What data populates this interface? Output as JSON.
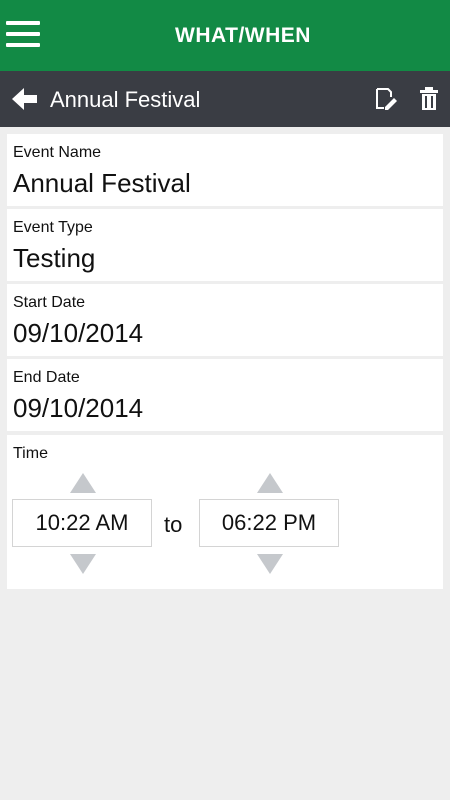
{
  "header": {
    "title": "WHAT/WHEN",
    "menu_icon": "hamburger-menu-icon"
  },
  "subheader": {
    "title": "Annual Festival",
    "back_icon": "back-arrow-icon",
    "edit_icon": "edit-icon",
    "delete_icon": "trash-icon"
  },
  "fields": [
    {
      "label": "Event Name",
      "value": "Annual Festival"
    },
    {
      "label": "Event Type",
      "value": "Testing"
    },
    {
      "label": "Start Date",
      "value": "09/10/2014"
    },
    {
      "label": "End Date",
      "value": "09/10/2014"
    }
  ],
  "time": {
    "label": "Time",
    "start": "10:22 AM",
    "separator": "to",
    "end": "06:22 PM"
  },
  "colors": {
    "header_bg": "#128a45",
    "subheader_bg": "#3a3d44",
    "page_bg": "#eeeeee",
    "arrow": "#c5c8cc"
  }
}
